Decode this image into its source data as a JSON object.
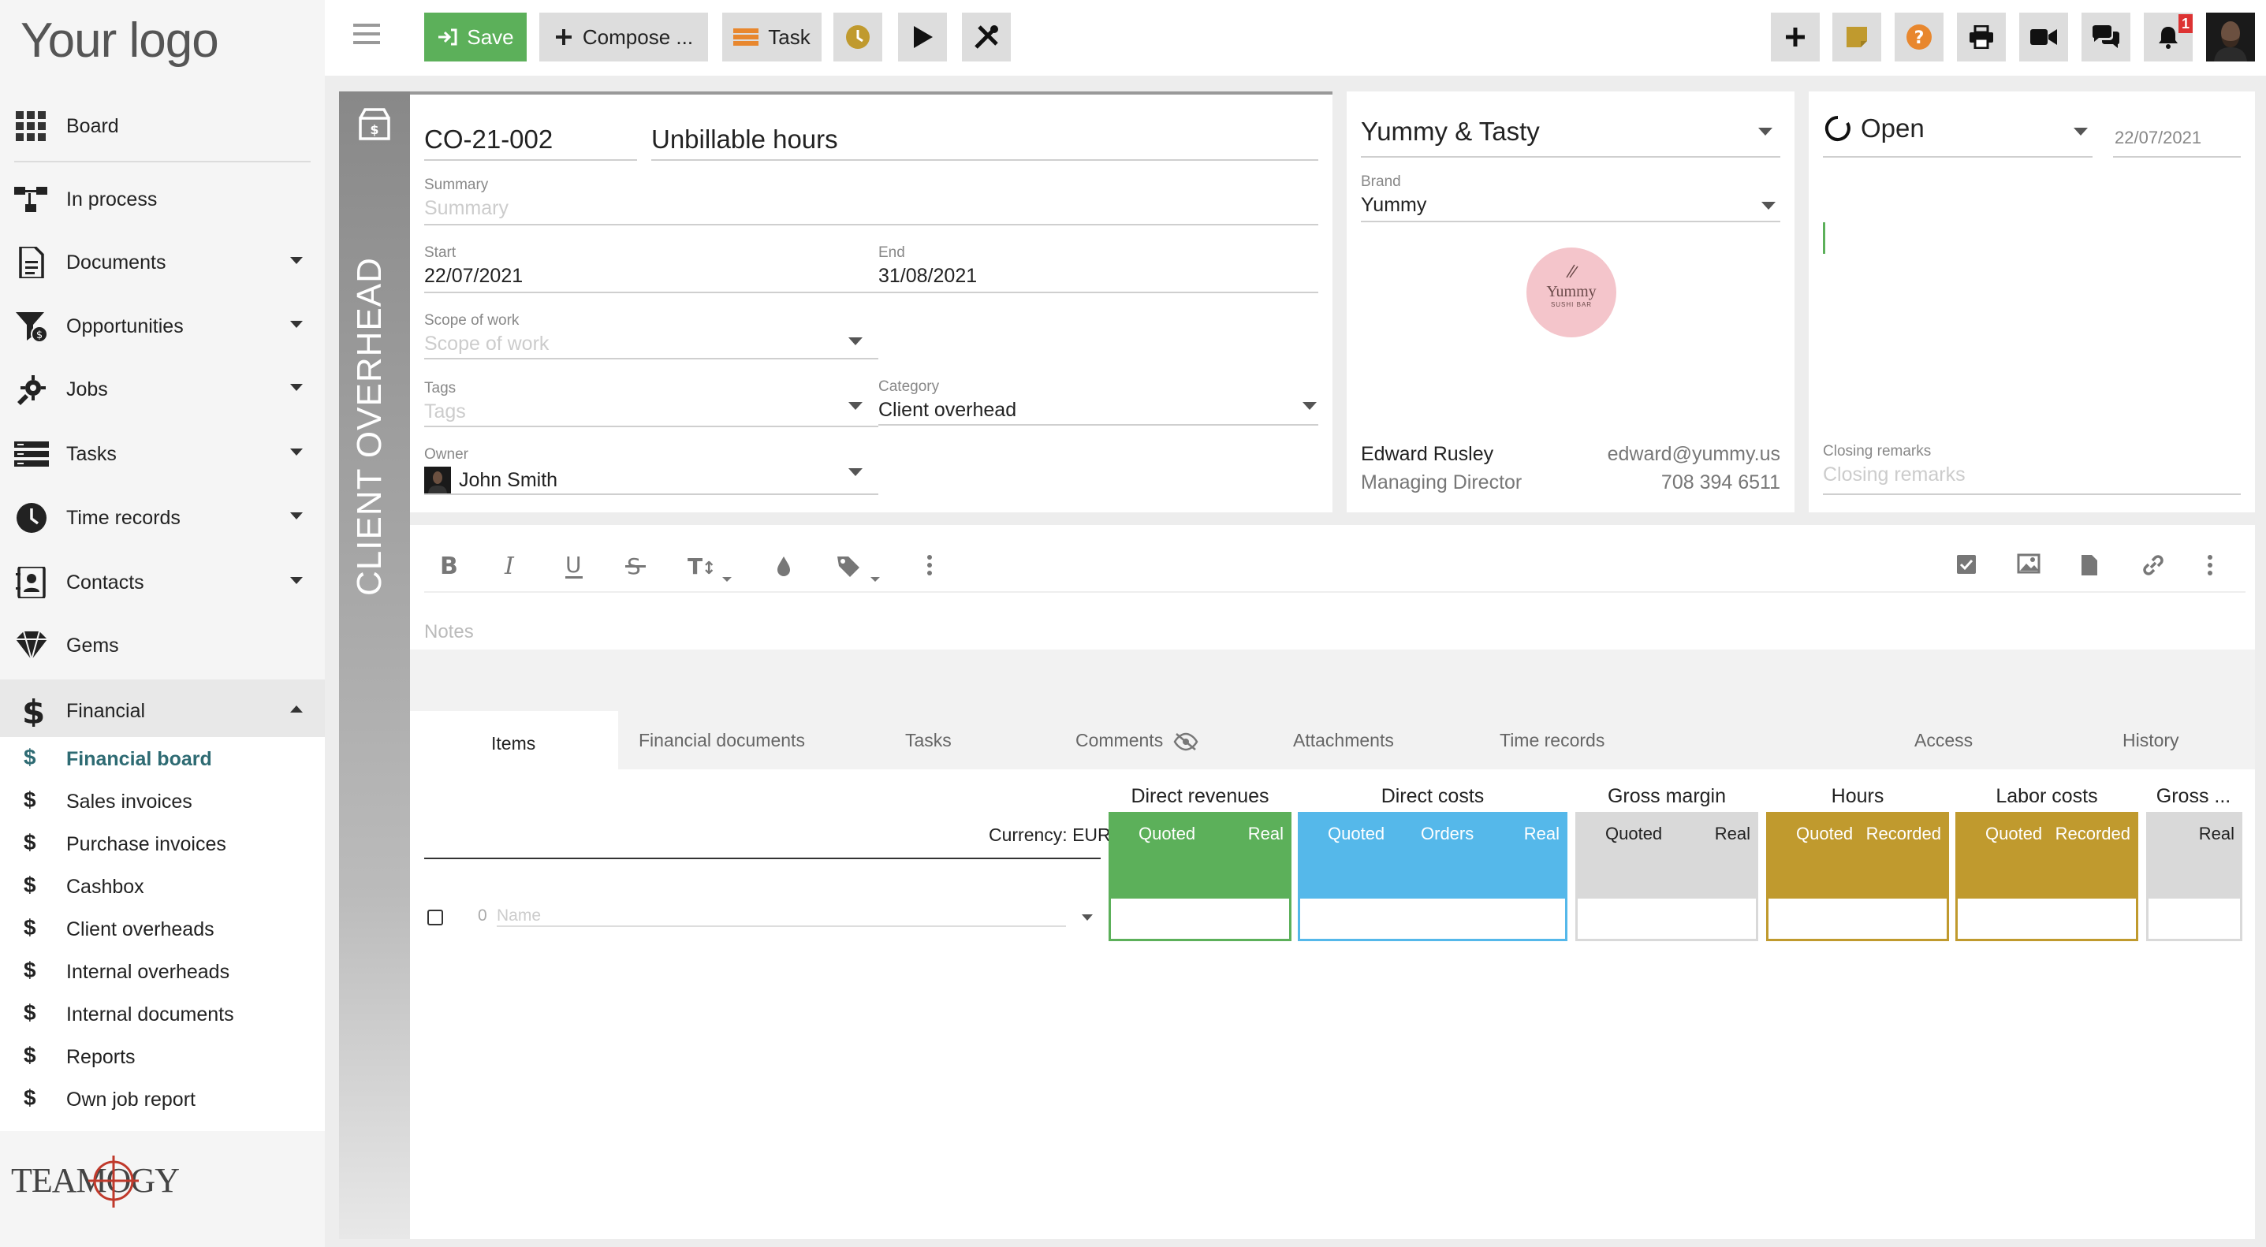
{
  "sidebar": {
    "logo": "Your logo",
    "items": [
      {
        "label": "Board"
      },
      {
        "label": "In process"
      },
      {
        "label": "Documents"
      },
      {
        "label": "Opportunities"
      },
      {
        "label": "Jobs"
      },
      {
        "label": "Tasks"
      },
      {
        "label": "Time records"
      },
      {
        "label": "Contacts"
      },
      {
        "label": "Gems"
      },
      {
        "label": "Financial"
      }
    ],
    "financial_sub": [
      {
        "label": "Financial board",
        "active": true
      },
      {
        "label": "Sales invoices"
      },
      {
        "label": "Purchase invoices"
      },
      {
        "label": "Cashbox"
      },
      {
        "label": "Client overheads"
      },
      {
        "label": "Internal overheads"
      },
      {
        "label": "Internal documents"
      },
      {
        "label": "Reports"
      },
      {
        "label": "Own job report"
      }
    ],
    "brand_footer": "TEAMOGY"
  },
  "toolbar": {
    "save_label": "Save",
    "compose_label": "Compose ...",
    "task_label": "Task",
    "notification_count": "1"
  },
  "record": {
    "side_label": "CLIENT OVERHEAD",
    "code": "CO-21-002",
    "title": "Unbillable hours",
    "summary_caption": "Summary",
    "summary_placeholder": "Summary",
    "start_caption": "Start",
    "start_value": "22/07/2021",
    "end_caption": "End",
    "end_value": "31/08/2021",
    "scope_caption": "Scope of work",
    "scope_placeholder": "Scope of work",
    "tags_caption": "Tags",
    "tags_placeholder": "Tags",
    "category_caption": "Category",
    "category_value": "Client overhead",
    "owner_caption": "Owner",
    "owner_value": "John Smith"
  },
  "client": {
    "name": "Yummy & Tasty",
    "brand_caption": "Brand",
    "brand_value": "Yummy",
    "logo_text": "Yummy",
    "logo_sub": "SUSHI BAR",
    "contact_name": "Edward Rusley",
    "contact_role": "Managing Director",
    "contact_email": "edward@yummy.us",
    "contact_phone": "708 394 6511"
  },
  "status": {
    "value": "Open",
    "date": "22/07/2021",
    "closing_caption": "Closing remarks",
    "closing_placeholder": "Closing remarks"
  },
  "editor": {
    "notes_placeholder": "Notes"
  },
  "tabs": [
    {
      "label": "Items",
      "active": true
    },
    {
      "label": "Financial documents"
    },
    {
      "label": "Tasks"
    },
    {
      "label": "Comments"
    },
    {
      "label": "Attachments"
    },
    {
      "label": "Time records"
    },
    {
      "label": "Access"
    },
    {
      "label": "History"
    }
  ],
  "items_table": {
    "currency": "Currency: EUR",
    "row_number": "0",
    "name_placeholder": "Name",
    "groups": [
      {
        "title": "Direct revenues",
        "color": "#5cb05a",
        "cols": [
          "Quoted",
          "Real"
        ]
      },
      {
        "title": "Direct costs",
        "color": "#55b8ea",
        "cols": [
          "Quoted",
          "Orders",
          "Real"
        ]
      },
      {
        "title": "Gross margin",
        "color": "#d9d9d9",
        "cols": [
          "Quoted",
          "Real"
        ]
      },
      {
        "title": "Hours",
        "color": "#c09a2e",
        "cols": [
          "Quoted",
          "Recorded"
        ]
      },
      {
        "title": "Labor costs",
        "color": "#c09a2e",
        "cols": [
          "Quoted",
          "Recorded"
        ]
      },
      {
        "title": "Gross ...",
        "color": "#d9d9d9",
        "cols": [
          "Real"
        ]
      }
    ]
  },
  "colors": {
    "save_green": "#5cb05a",
    "active_teal": "#2e6b73"
  }
}
